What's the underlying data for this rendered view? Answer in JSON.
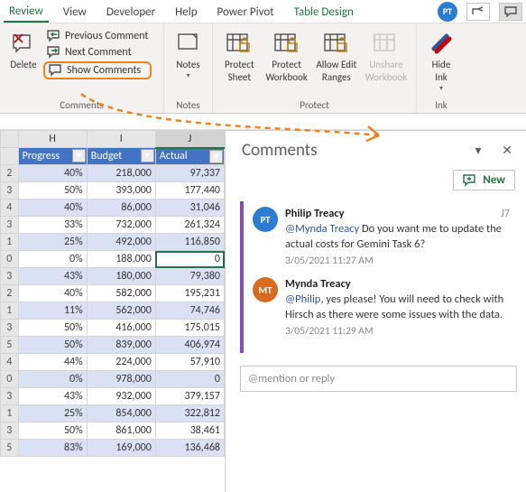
{
  "tabs": {
    "review": "Review",
    "view": "View",
    "developer": "Developer",
    "help": "Help",
    "powerpivot": "Power Pivot",
    "tabledesign": "Table Design",
    "user_initials": "PT"
  },
  "ribbon": {
    "comments_group": {
      "delete": "Delete",
      "previous": "Previous Comment",
      "next": "Next Comment",
      "show": "Show Comments",
      "label": "Comments"
    },
    "notes_group": {
      "notes": "Notes",
      "label": "Notes"
    },
    "protect_group": {
      "protect_sheet_l1": "Protect",
      "protect_sheet_l2": "Sheet",
      "protect_wb_l1": "Protect",
      "protect_wb_l2": "Workbook",
      "allow_edit_l1": "Allow Edit",
      "allow_edit_l2": "Ranges",
      "unshare_l1": "Unshare",
      "unshare_l2": "Workbook",
      "label": "Protect"
    },
    "ink_group": {
      "hide_l1": "Hide",
      "hide_l2": "Ink",
      "label": "Ink"
    }
  },
  "sheet": {
    "columns": {
      "H": "H",
      "I": "I",
      "J": "J"
    },
    "headers": {
      "progress": "Progress",
      "budget": "Budget",
      "actual": "Actual"
    },
    "rows": [
      {
        "r": "2",
        "p": "40%",
        "b": "218,000",
        "a": "97,337"
      },
      {
        "r": "3",
        "p": "50%",
        "b": "393,000",
        "a": "177,440"
      },
      {
        "r": "4",
        "p": "40%",
        "b": "86,000",
        "a": "31,046"
      },
      {
        "r": "3",
        "p": "33%",
        "b": "732,000",
        "a": "261,324"
      },
      {
        "r": "1",
        "p": "25%",
        "b": "492,000",
        "a": "116,850"
      },
      {
        "r": "0",
        "p": "0%",
        "b": "188,000",
        "a": "0",
        "current": true
      },
      {
        "r": "3",
        "p": "43%",
        "b": "180,000",
        "a": "79,380"
      },
      {
        "r": "2",
        "p": "40%",
        "b": "582,000",
        "a": "195,231"
      },
      {
        "r": "1",
        "p": "11%",
        "b": "562,000",
        "a": "74,746"
      },
      {
        "r": "3",
        "p": "50%",
        "b": "416,000",
        "a": "175,015"
      },
      {
        "r": "5",
        "p": "50%",
        "b": "839,000",
        "a": "406,974"
      },
      {
        "r": "4",
        "p": "44%",
        "b": "224,000",
        "a": "57,910"
      },
      {
        "r": "0",
        "p": "0%",
        "b": "978,000",
        "a": "0"
      },
      {
        "r": "3",
        "p": "43%",
        "b": "932,000",
        "a": "379,157"
      },
      {
        "r": "1",
        "p": "25%",
        "b": "854,000",
        "a": "322,812"
      },
      {
        "r": "3",
        "p": "50%",
        "b": "861,000",
        "a": "38,461"
      },
      {
        "r": "5",
        "p": "83%",
        "b": "169,000",
        "a": "136,468"
      }
    ]
  },
  "pane": {
    "title": "Comments",
    "new": "New",
    "reply_placeholder": "@mention or reply",
    "thread": {
      "cell_ref": "J7",
      "c1": {
        "initials": "PT",
        "author": "Philip Treacy",
        "mention": "@Mynda Treacy",
        "text": " Do you want me to update the actual costs for Gemini Task 6?",
        "time": "3/05/2021 11:27 AM"
      },
      "c2": {
        "initials": "MT",
        "author": "Mynda Treacy",
        "mention": "@Philip",
        "text": ", yes please! You will need to check with Hirsch as there were some issues with the data.",
        "time": "3/05/2021 11:29 AM"
      }
    }
  }
}
